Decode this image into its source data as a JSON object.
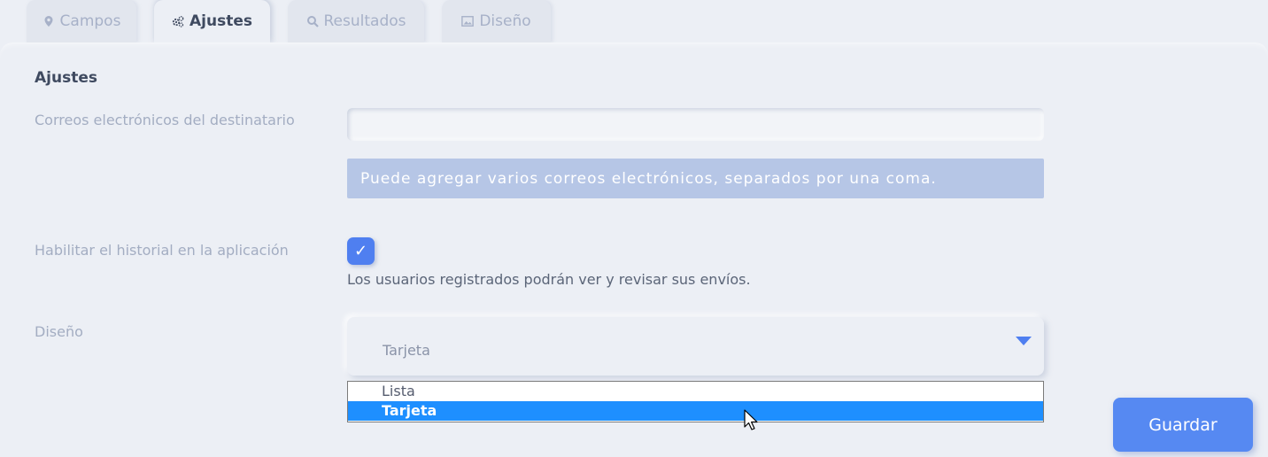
{
  "tabs": [
    {
      "label": "Campos",
      "icon": "map-pin-icon",
      "active": false
    },
    {
      "label": "Ajustes",
      "icon": "gears-icon",
      "active": true
    },
    {
      "label": "Resultados",
      "icon": "search-icon",
      "active": false
    },
    {
      "label": "Diseño",
      "icon": "image-icon",
      "active": false
    }
  ],
  "settings": {
    "title": "Ajustes",
    "emails": {
      "label": "Correos electrónicos del destinatario",
      "value": "",
      "hint": "Puede agregar varios correos electrónicos, separados por una coma."
    },
    "history": {
      "label": "Habilitar el historial en la aplicación",
      "checked": true,
      "description": "Los usuarios registrados podrán ver y revisar sus envíos."
    },
    "layout": {
      "label": "Diseño",
      "selected": "Tarjeta",
      "options": [
        "Lista",
        "Tarjeta"
      ],
      "highlighted_index": 1
    }
  },
  "actions": {
    "save_label": "Guardar"
  },
  "colors": {
    "accent": "#4f7ff0",
    "hint_bg": "#b6c6e6",
    "highlight": "#1e8fff",
    "background": "#eceff5"
  }
}
